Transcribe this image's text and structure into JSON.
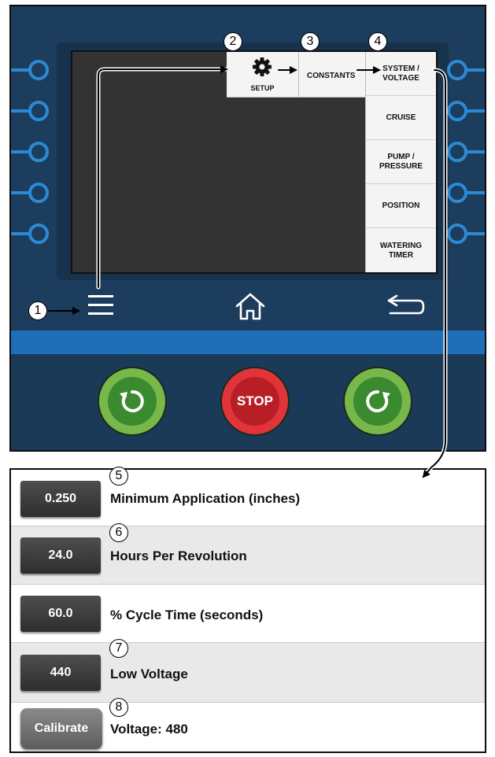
{
  "callouts": [
    "1",
    "2",
    "3",
    "4",
    "5",
    "6",
    "7",
    "8"
  ],
  "screen": {
    "setup_label": "SETUP",
    "constants_label": "CONSTANTS",
    "menu_items": [
      {
        "line1": "SYSTEM /",
        "line2": "VOLTAGE"
      },
      {
        "line1": "CRUISE",
        "line2": ""
      },
      {
        "line1": "PUMP /",
        "line2": "PRESSURE"
      },
      {
        "line1": "POSITION",
        "line2": ""
      },
      {
        "line1": "WATERING",
        "line2": "TIMER"
      }
    ]
  },
  "nav": {
    "menu_icon": "hamburger-menu-icon",
    "home_icon": "home-icon",
    "back_icon": "back-arrow-icon"
  },
  "controls": {
    "reverse_icon": "rotate-counterclockwise-icon",
    "stop_label": "STOP",
    "forward_icon": "rotate-clockwise-icon"
  },
  "settings": {
    "rows": [
      {
        "value": "0.250",
        "label": "Minimum Application (inches)"
      },
      {
        "value": "24.0",
        "label": "Hours Per Revolution"
      },
      {
        "value": "60.0",
        "label": "% Cycle Time (seconds)"
      },
      {
        "value": "440",
        "label": "Low Voltage"
      }
    ],
    "calibrate_label": "Calibrate",
    "voltage_label": "Voltage: 480"
  },
  "colors": {
    "panel": "#1c3d5d",
    "accent_blue": "#2c8ad4",
    "go_green": "#78b84a",
    "stop_red": "#e0333a"
  }
}
